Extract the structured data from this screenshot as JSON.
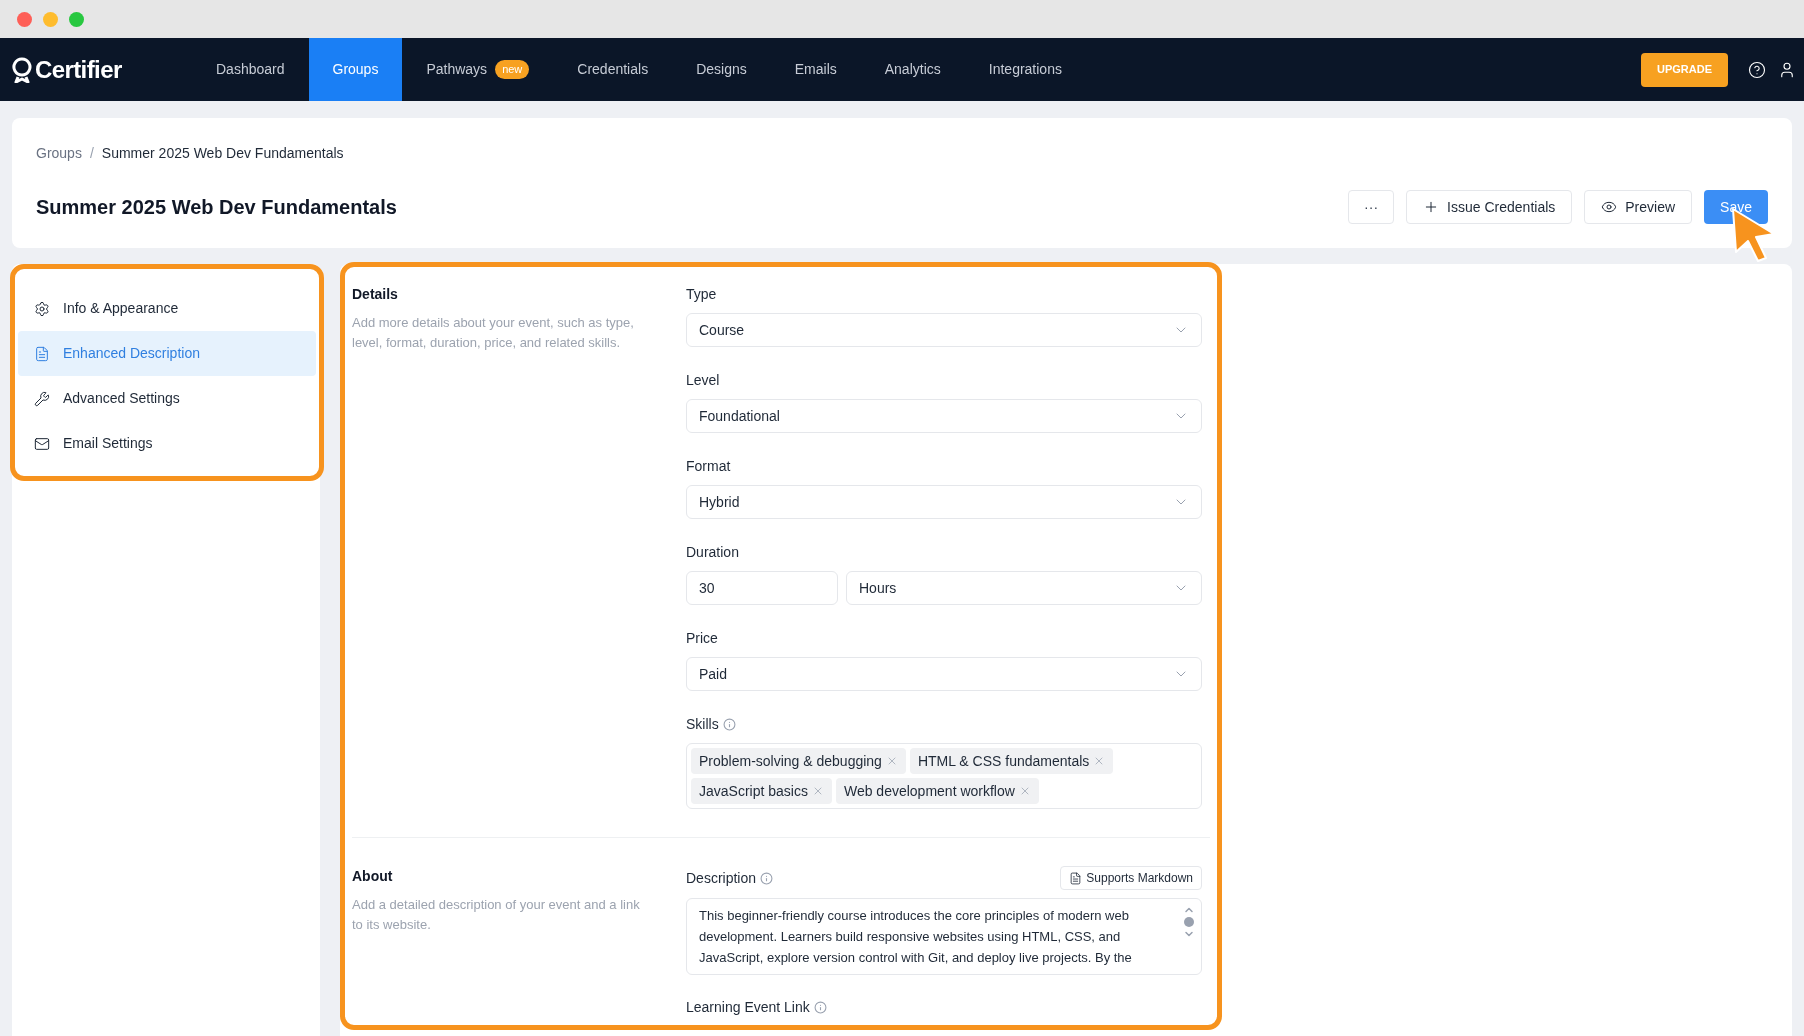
{
  "window": {
    "controls": [
      {
        "color": "#fe5f57"
      },
      {
        "color": "#febc2e"
      },
      {
        "color": "#28c840"
      }
    ]
  },
  "nav": {
    "logo": "Certifier",
    "items": [
      {
        "label": "Dashboard",
        "selected": false
      },
      {
        "label": "Groups",
        "selected": true
      },
      {
        "label": "Pathways",
        "selected": false,
        "badge": "new"
      },
      {
        "label": "Credentials",
        "selected": false
      },
      {
        "label": "Designs",
        "selected": false
      },
      {
        "label": "Emails",
        "selected": false
      },
      {
        "label": "Analytics",
        "selected": false
      },
      {
        "label": "Integrations",
        "selected": false
      }
    ],
    "upgrade": "UPGRADE"
  },
  "breadcrumb": {
    "items": [
      "Groups",
      "Summer 2025 Web Dev Fundamentals"
    ],
    "separator": "/"
  },
  "page_title": "Summer 2025 Web Dev Fundamentals",
  "actions": {
    "more": "···",
    "issue": "Issue Credentials",
    "preview": "Preview",
    "save": "Save"
  },
  "sidebar": [
    {
      "label": "Info & Appearance",
      "selected": false
    },
    {
      "label": "Enhanced Description",
      "selected": true
    },
    {
      "label": "Advanced Settings",
      "selected": false
    },
    {
      "label": "Email Settings",
      "selected": false
    }
  ],
  "sections": [
    {
      "title": "Details",
      "description": "Add more details about your event, such as type, level, format, duration, price, and related skills.",
      "fields": [
        {
          "kind": "select",
          "label": "Type",
          "info": false,
          "value": "Course"
        },
        {
          "kind": "select",
          "label": "Level",
          "info": false,
          "value": "Foundational"
        },
        {
          "kind": "select",
          "label": "Format",
          "info": false,
          "value": "Hybrid"
        },
        {
          "kind": "duration",
          "label": "Duration",
          "info": false,
          "value": "30",
          "unit": "Hours"
        },
        {
          "kind": "select",
          "label": "Price",
          "info": false,
          "value": "Paid"
        },
        {
          "kind": "tags",
          "label": "Skills",
          "info": true,
          "tags": [
            "Problem-solving & debugging",
            "HTML & CSS fundamentals",
            "JavaScript basics",
            "Web development workflow"
          ]
        }
      ]
    },
    {
      "title": "About",
      "description": "Add a detailed description of your event and a link to its website.",
      "fields": [
        {
          "kind": "textarea",
          "label": "Description",
          "info": true,
          "badge": "Supports Markdown",
          "value": "This beginner-friendly course introduces the core principles of modern web development. Learners build responsive websites using HTML, CSS, and JavaScript, explore version control with Git, and deploy live projects. By the"
        },
        {
          "kind": "heading",
          "label": "Learning Event Link",
          "info": true
        }
      ]
    }
  ]
}
